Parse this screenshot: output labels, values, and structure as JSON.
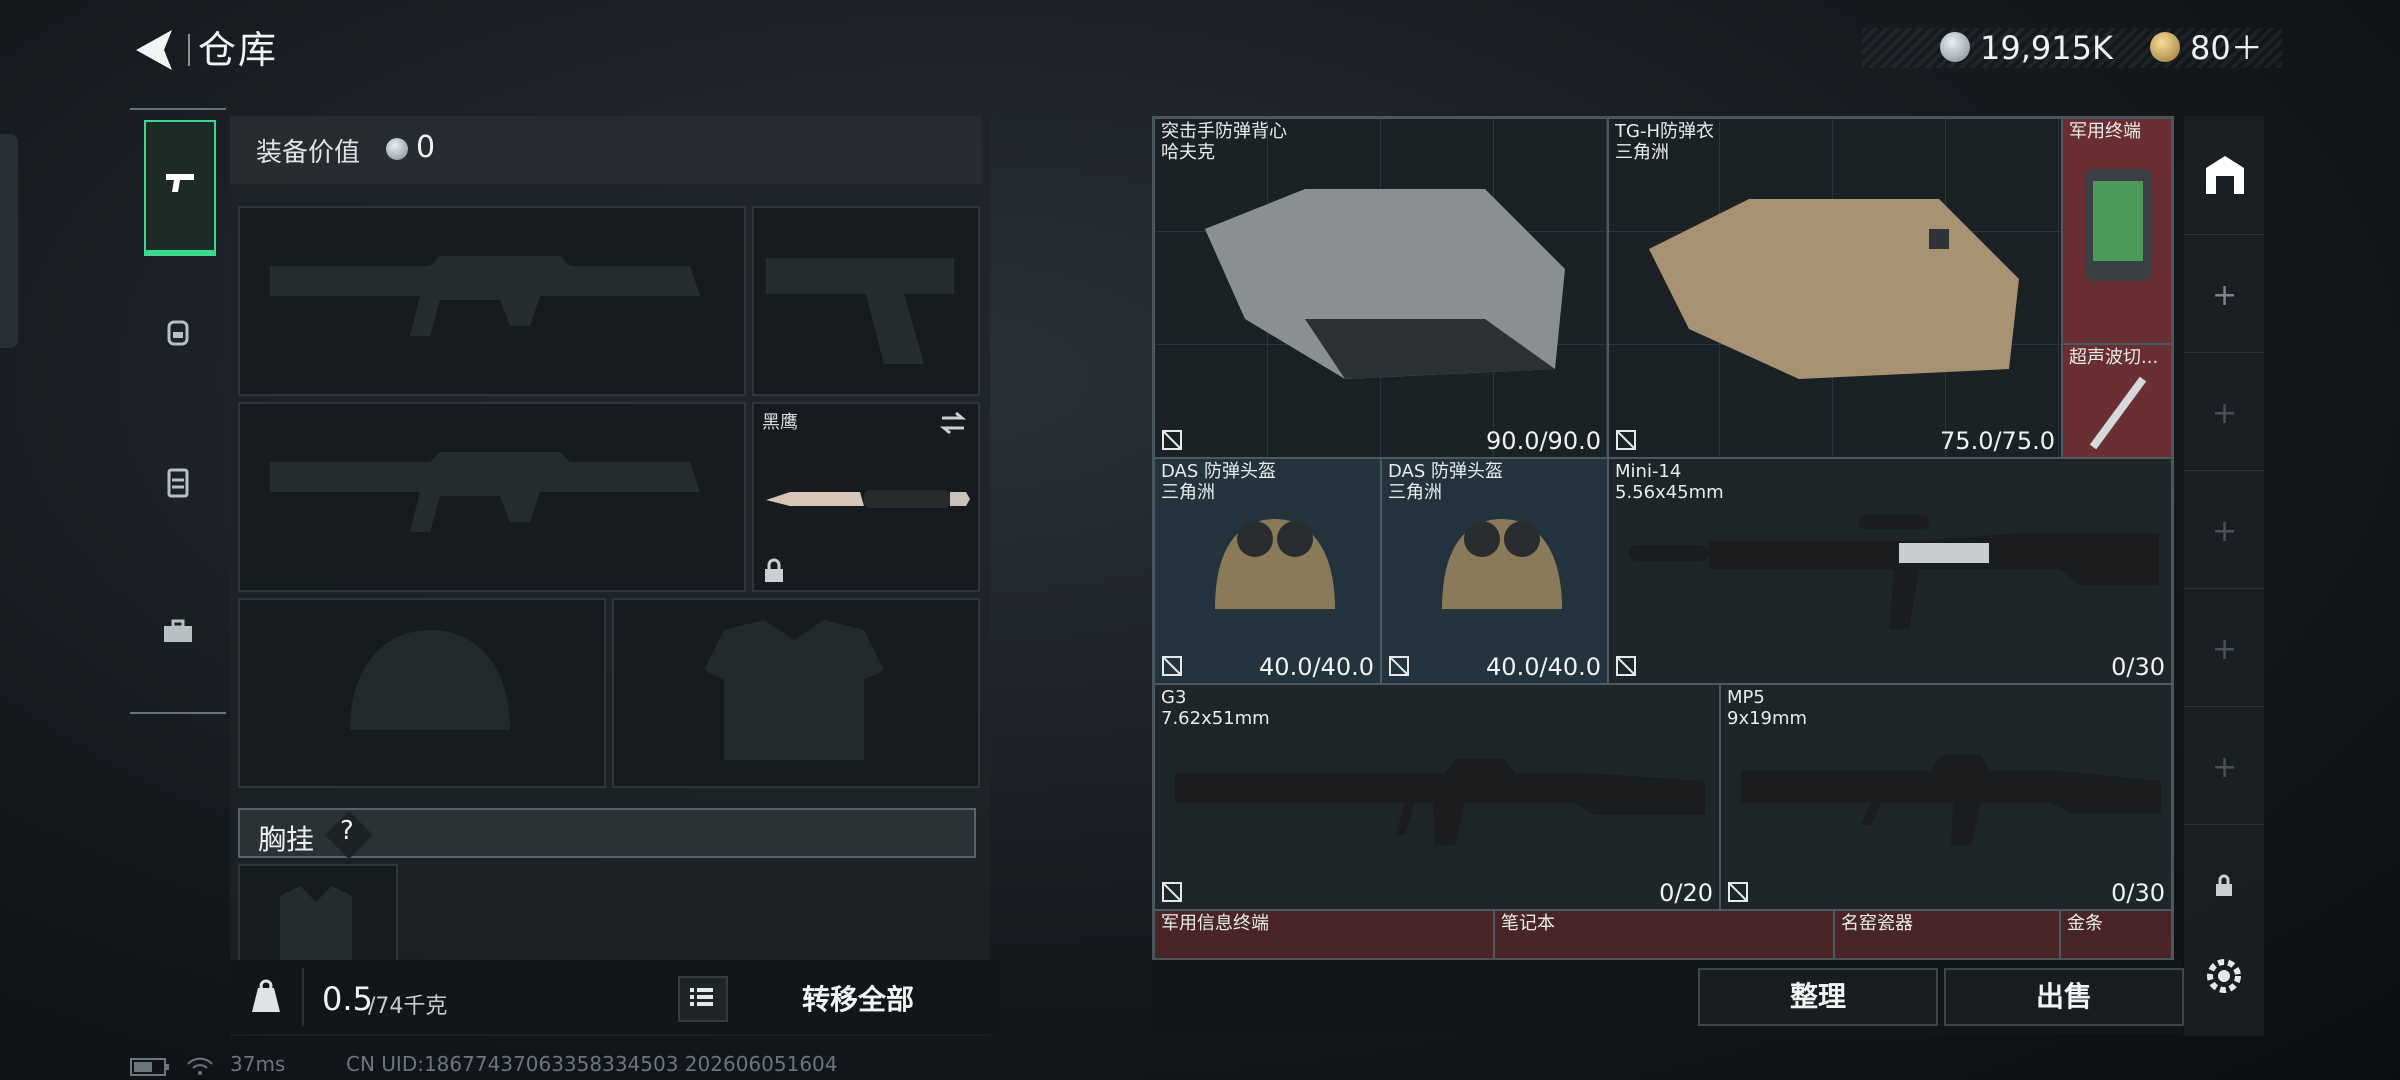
{
  "header": {
    "title": "仓库",
    "currency": [
      {
        "icon": "silver-coin-icon",
        "value": "19,915K"
      },
      {
        "icon": "gold-coin-icon",
        "value": "80＋"
      }
    ]
  },
  "tabs": [
    {
      "icon": "pistol-icon",
      "active": true
    },
    {
      "icon": "backpack-icon",
      "active": false
    },
    {
      "icon": "chest-rig-icon",
      "active": false
    },
    {
      "icon": "toolbox-icon",
      "active": false
    }
  ],
  "equipment": {
    "value_label": "装备价值",
    "value": "0",
    "knife_slot_label": "黑鹰",
    "chest_rig_label": "胸挂",
    "help": "?"
  },
  "weight": {
    "current": "0.5",
    "max": "/74千克"
  },
  "transfer_all": "转移全部",
  "storage_items": [
    {
      "name": "突击手防弹背心\n哈夫克",
      "durability": "90.0/90.0",
      "color": "#3a2e3b"
    },
    {
      "name": "TG-H防弹衣\n三角洲",
      "durability": "75.0/75.0",
      "color": "#23343f"
    },
    {
      "name": "军用终端",
      "durability": "",
      "color": "#6a2f32"
    },
    {
      "name": "超声波切...",
      "durability": "",
      "color": "#6a2f32"
    },
    {
      "name": "DAS 防弹头盔\n三角洲",
      "durability": "40.0/40.0",
      "color": "#23343f"
    },
    {
      "name": "DAS 防弹头盔\n三角洲",
      "durability": "40.0/40.0",
      "color": "#23343f"
    },
    {
      "name": "Mini-14\n5.56x45mm",
      "durability": "0/30",
      "color": "#1f262a"
    },
    {
      "name": "G3\n7.62x51mm",
      "durability": "0/20",
      "color": "#1f262a"
    },
    {
      "name": "MP5\n9x19mm",
      "durability": "0/30",
      "color": "#1f262a"
    },
    {
      "name": "军用信息终端",
      "durability": "",
      "color": "#4a2528"
    },
    {
      "name": "笔记本",
      "durability": "",
      "color": "#4a2528"
    },
    {
      "name": "名窑瓷器",
      "durability": "",
      "color": "#4a2528"
    },
    {
      "name": "金条",
      "durability": "",
      "color": "#4a2528"
    }
  ],
  "actions": {
    "organize": "整理",
    "sell": "出售"
  },
  "status": {
    "ping": "37ms",
    "uid": "CN UID:18677437063358334503 202606051604"
  }
}
